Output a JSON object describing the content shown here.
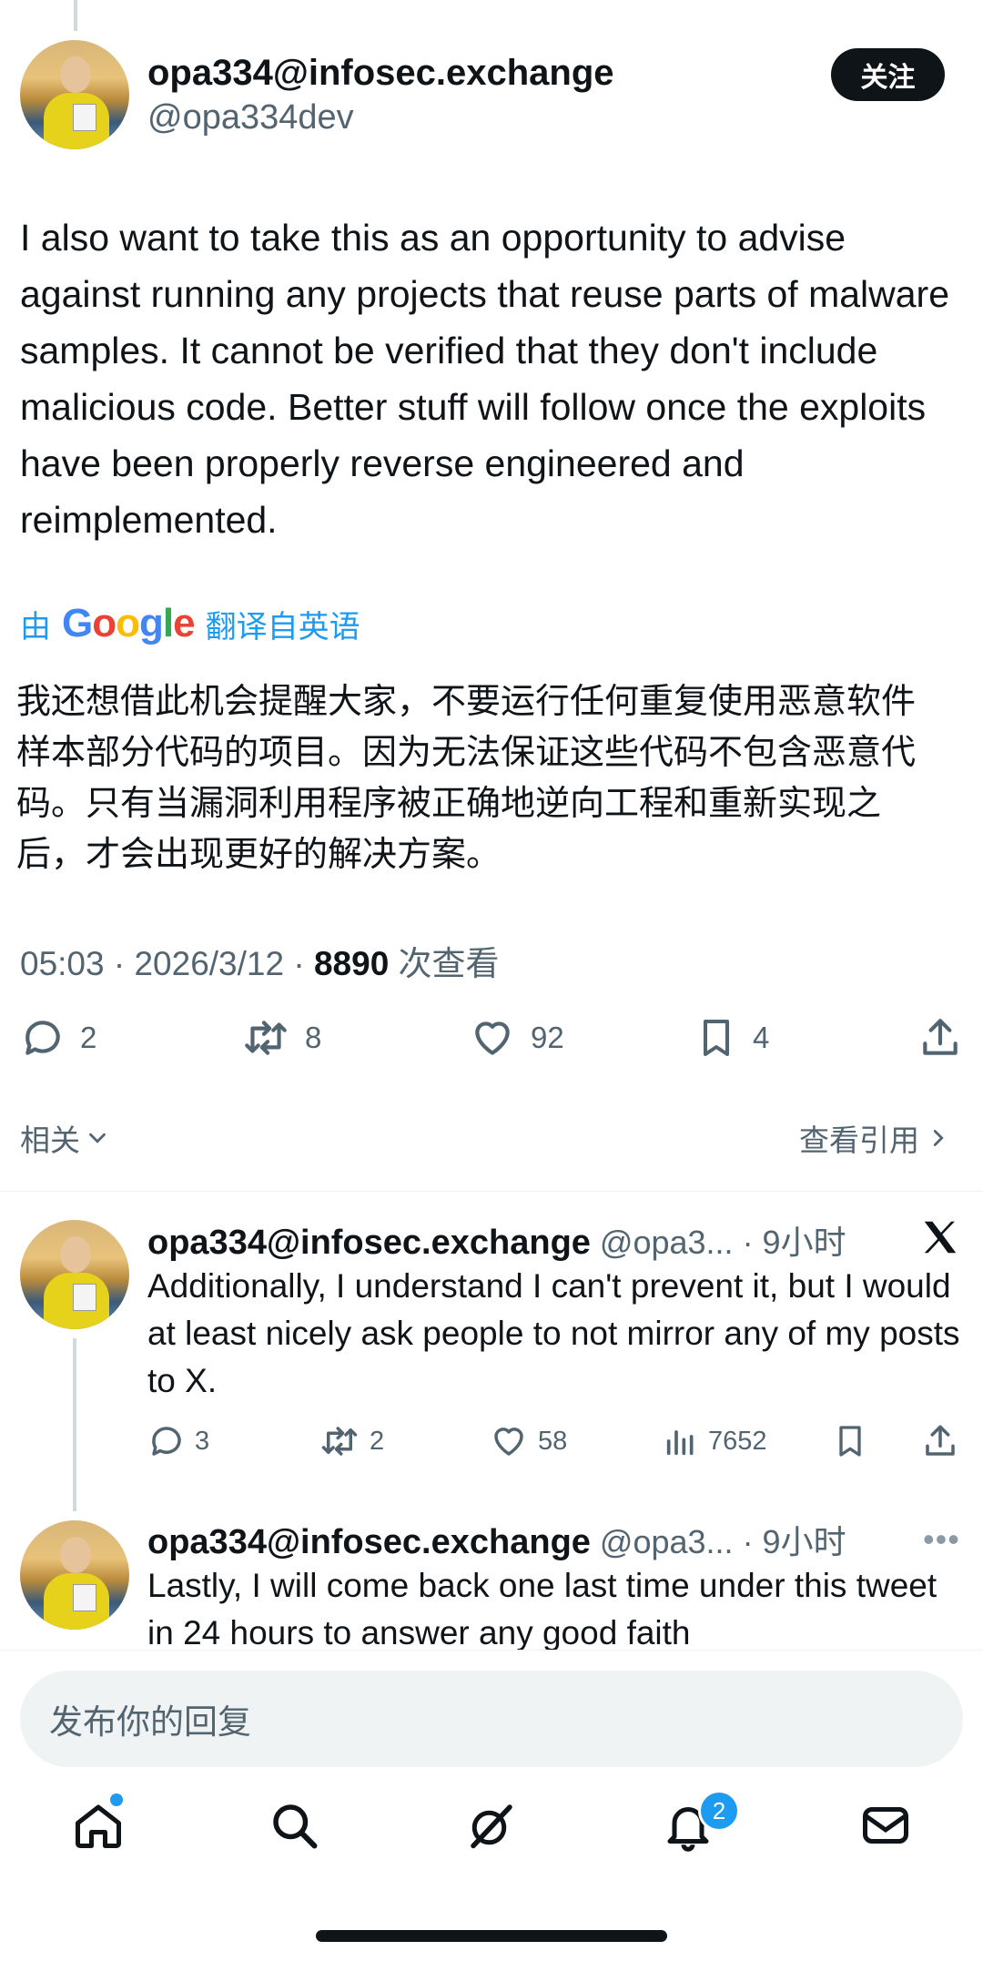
{
  "tweet": {
    "display_name": "opa334@infosec.exchange",
    "handle": "@opa334dev",
    "follow_label": "关注",
    "text": "I also want to take this as an opportunity to advise against running any projects that reuse parts of malware samples. It cannot be verified that they don't include malicious code. Better stuff will follow once the exploits have been properly reverse engineered and reimplemented.",
    "translate_prefix": "由",
    "translate_brand": "Google",
    "translate_suffix": "翻译自英语",
    "translated_text": "我还想借此机会提醒大家，不要运行任何重复使用恶意软件样本部分代码的项目。因为无法保证这些代码不包含恶意代码。只有当漏洞利用程序被正确地逆向工程和重新实现之后，才会出现更好的解决方案。",
    "time": "05:03 · 2026/3/12 · ",
    "views": "8890",
    "views_label": " 次查看",
    "replies": "2",
    "retweets": "8",
    "likes": "92",
    "bookmarks": "4"
  },
  "related": {
    "label": "相关",
    "quotes_label": "查看引用"
  },
  "replies": [
    {
      "display_name": "opa334@infosec.exchange",
      "meta": " @opa3... · 9小时",
      "text": "Additionally, I understand I can't prevent it, but I would at least nicely ask people to not mirror any of my posts to X.",
      "replies": "3",
      "retweets": "2",
      "likes": "58",
      "views": "7652"
    },
    {
      "display_name": "opa334@infosec.exchange",
      "meta": " @opa3... · 9小时",
      "text": "Lastly, I will come back one last time under this tweet in 24 hours to answer any good faith"
    }
  ],
  "reply_box": {
    "placeholder": "发布你的回复"
  },
  "tabbar": {
    "notifications_badge": "2"
  },
  "colors": {
    "accent": "#1d9bf0",
    "text": "#0f1419",
    "secondary": "#536471"
  },
  "icons": [
    "comment-icon",
    "retweet-icon",
    "heart-icon",
    "bookmark-icon",
    "share-icon",
    "views-icon",
    "x-logo-icon",
    "more-icon",
    "chevron-down-icon",
    "chevron-right-icon",
    "home-icon",
    "search-icon",
    "grok-icon",
    "bell-icon",
    "mail-icon"
  ]
}
